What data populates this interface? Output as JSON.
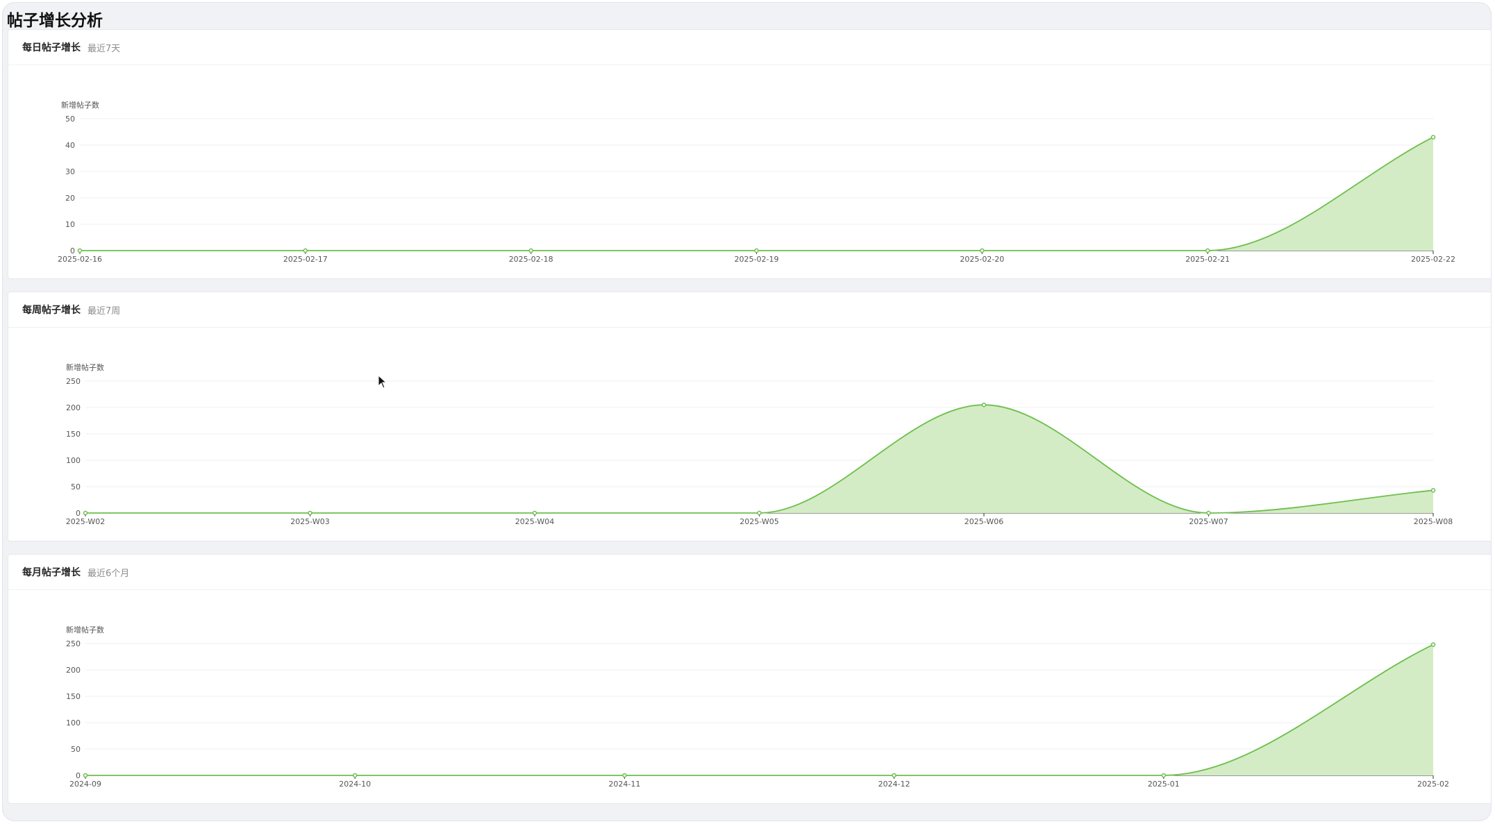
{
  "page": {
    "title": "帖子增长分析"
  },
  "colors": {
    "line": "#6cbf4c",
    "fill": "#d4ecc5",
    "grid": "#efefef",
    "axis": "#333333",
    "tick_text": "#555555"
  },
  "cards": [
    {
      "title": "每日帖子增长",
      "subtitle": "最近7天"
    },
    {
      "title": "每周帖子增长",
      "subtitle": "最近7周"
    },
    {
      "title": "每月帖子增长",
      "subtitle": "最近6个月"
    }
  ],
  "chart_data": [
    {
      "type": "area",
      "ylabel": "新增帖子数",
      "categories": [
        "2025-02-16",
        "2025-02-17",
        "2025-02-18",
        "2025-02-19",
        "2025-02-20",
        "2025-02-21",
        "2025-02-22"
      ],
      "values": [
        0,
        0,
        0,
        0,
        0,
        0,
        43
      ],
      "ylim": [
        0,
        50
      ],
      "yticks": [
        0,
        10,
        20,
        30,
        40,
        50
      ],
      "smooth": true,
      "grid": true
    },
    {
      "type": "area",
      "ylabel": "新增帖子数",
      "categories": [
        "2025-W02",
        "2025-W03",
        "2025-W04",
        "2025-W05",
        "2025-W06",
        "2025-W07",
        "2025-W08"
      ],
      "values": [
        0,
        0,
        0,
        0,
        205,
        0,
        43
      ],
      "ylim": [
        0,
        250
      ],
      "yticks": [
        0,
        50,
        100,
        150,
        200,
        250
      ],
      "smooth": true,
      "grid": true
    },
    {
      "type": "area",
      "ylabel": "新增帖子数",
      "categories": [
        "2024-09",
        "2024-10",
        "2024-11",
        "2024-12",
        "2025-01",
        "2025-02"
      ],
      "values": [
        0,
        0,
        0,
        0,
        0,
        248
      ],
      "ylim": [
        0,
        250
      ],
      "yticks": [
        0,
        50,
        100,
        150,
        200,
        250
      ],
      "smooth": true,
      "grid": true
    }
  ]
}
